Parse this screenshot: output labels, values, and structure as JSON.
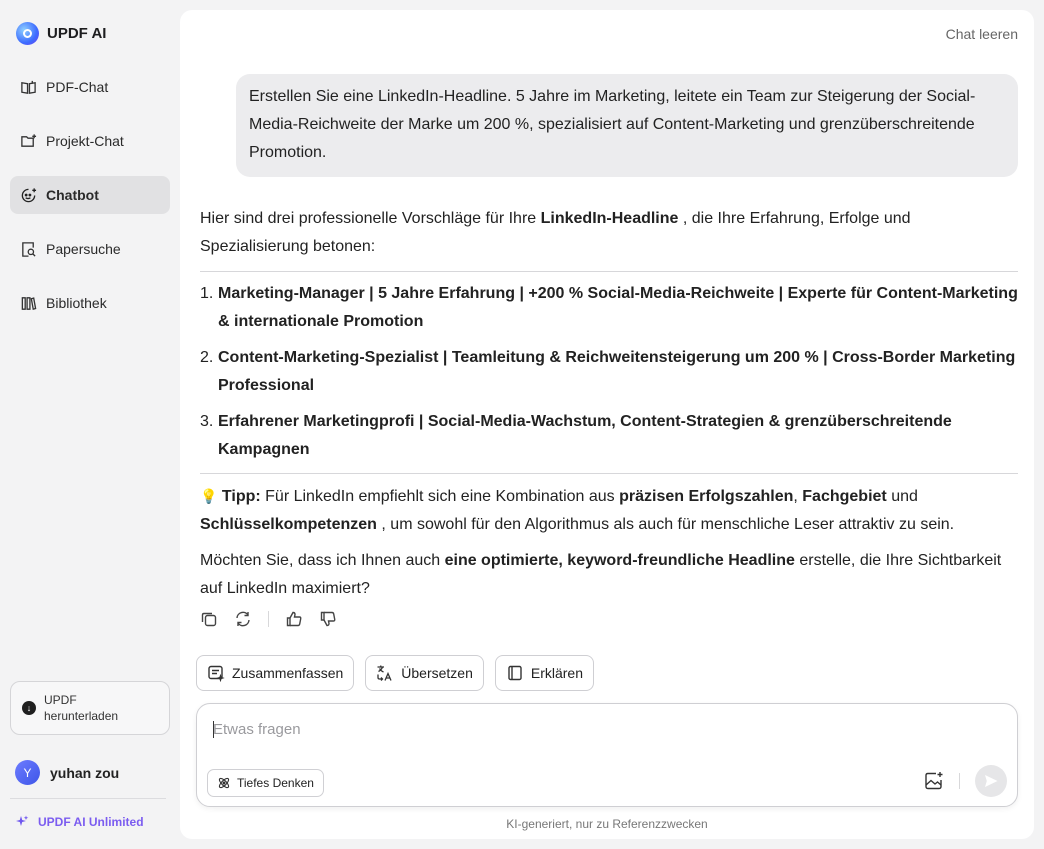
{
  "brand": {
    "name": "UPDF AI"
  },
  "sidebar": {
    "items": [
      {
        "label": "PDF-Chat",
        "icon": "book-open-icon"
      },
      {
        "label": "Projekt-Chat",
        "icon": "folder-plus-icon"
      },
      {
        "label": "Chatbot",
        "icon": "chat-bot-icon",
        "active": true
      },
      {
        "label": "Papersuche",
        "icon": "doc-search-icon"
      },
      {
        "label": "Bibliothek",
        "icon": "library-icon"
      }
    ],
    "download_label": "UPDF herunterladen",
    "user": {
      "initial": "Y",
      "name": "yuhan zou"
    },
    "unlimited_label": "UPDF AI Unlimited"
  },
  "header": {
    "clear_chat": "Chat leeren"
  },
  "conversation": {
    "user_message": "Erstellen Sie eine LinkedIn-Headline. 5 Jahre im Marketing, leitete ein Team zur Steigerung der Social-Media-Reichweite der Marke um 200 %, spezialisiert auf Content-Marketing und grenzüberschreitende Promotion.",
    "answer": {
      "intro_a": "Hier sind drei professionelle Vorschläge für Ihre ",
      "intro_bold": "LinkedIn-Headline",
      "intro_b": " , die Ihre Erfahrung, Erfolge und Spezialisierung betonen:",
      "items": [
        {
          "num": "1.",
          "text": "Marketing-Manager | 5 Jahre Erfahrung | +200 % Social-Media-Reichweite | Experte für Content-Marketing & internationale Promotion"
        },
        {
          "num": "2.",
          "text": "Content-Marketing-Spezialist | Teamleitung & Reichweitensteigerung um 200 % | Cross-Border Marketing Professional"
        },
        {
          "num": "3.",
          "text": "Erfahrener Marketingprofi | Social-Media-Wachstum, Content-Strategien & grenzüberschreitende Kampagnen"
        }
      ],
      "tip_icon": "💡",
      "tip_label": "Tipp:",
      "tip_a": " Für LinkedIn empfiehlt sich eine Kombination aus ",
      "tip_b1": "präzisen Erfolgszahlen",
      "tip_c": ", ",
      "tip_b2": "Fachgebiet",
      "tip_d": " und ",
      "tip_b3": "Schlüsselkompetenzen",
      "tip_e": " , um sowohl für den Algorithmus als auch für menschliche Leser attraktiv zu sein.",
      "question_a": "Möchten Sie, dass ich Ihnen auch ",
      "question_bold": "eine optimierte, keyword-freundliche Headline",
      "question_b": " erstelle, die Ihre Sichtbarkeit auf LinkedIn maximiert?"
    }
  },
  "chips": {
    "summarize": "Zusammenfassen",
    "translate": "Übersetzen",
    "explain": "Erklären"
  },
  "input": {
    "placeholder": "Etwas fragen",
    "deep_think": "Tiefes Denken"
  },
  "footer_note": "KI-generiert, nur zu Referenzzwecken"
}
